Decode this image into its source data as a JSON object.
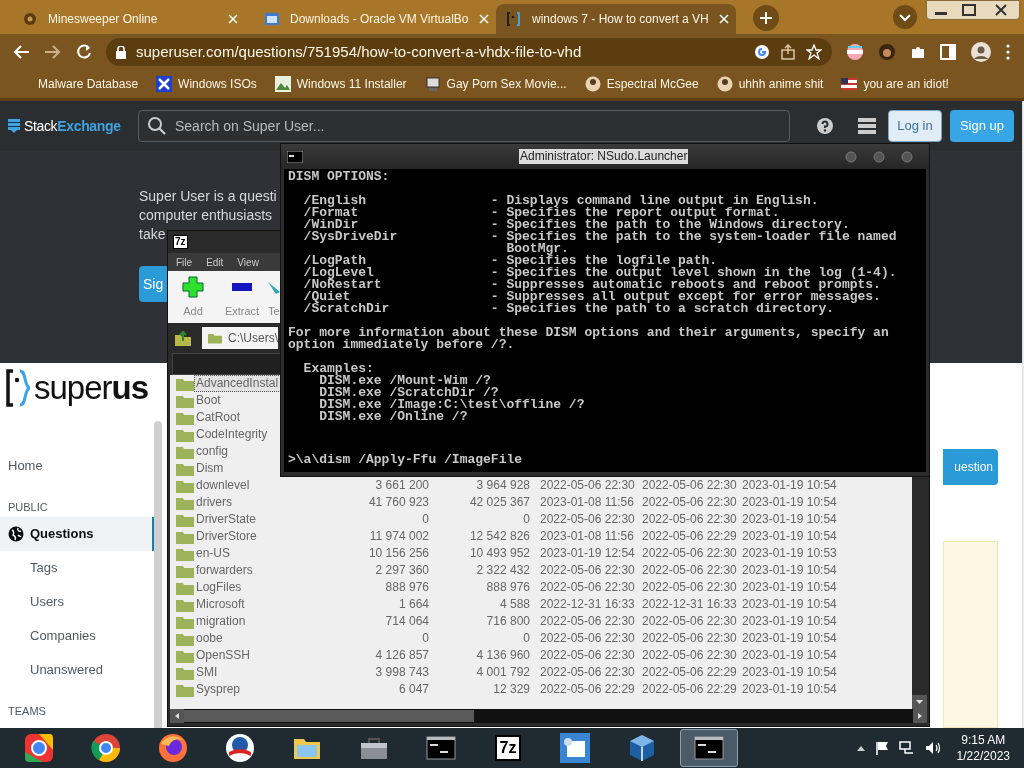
{
  "browser": {
    "tabs": [
      {
        "title": "Minesweeper Online",
        "selected": false,
        "kind": "gear"
      },
      {
        "title": "Downloads - Oracle VM VirtualBo",
        "selected": false,
        "kind": "window"
      },
      {
        "title": "windows 7 - How to convert a VH",
        "selected": true,
        "kind": "bracket"
      }
    ],
    "url": "superuser.com/questions/751954/how-to-convert-a-vhdx-file-to-vhd",
    "bookmarks": [
      {
        "label": "Malware Database",
        "kind": "plain"
      },
      {
        "label": "Windows ISOs",
        "kind": "x"
      },
      {
        "label": "Windows 11 Installer",
        "kind": "image"
      },
      {
        "label": "Gay Porn Sex Movie...",
        "kind": "computer"
      },
      {
        "label": "Espectral McGee",
        "kind": "avatar"
      },
      {
        "label": "uhhh anime shit",
        "kind": "avatar"
      },
      {
        "label": "you are an idiot!",
        "kind": "flag"
      }
    ]
  },
  "site": {
    "logo": "Stack**Exchange**",
    "search_placeholder": "Search on Super User...",
    "login": "Log in",
    "signup": "Sign up",
    "hero_lines": [
      "Super User is a questi",
      "computer enthusiasts",
      "take"
    ],
    "hero_button": "Sig",
    "brand": "super**us**",
    "sidebar": [
      {
        "label": "Home",
        "kind": "link",
        "selected": false
      },
      {
        "label": "PUBLIC",
        "kind": "heading",
        "selected": false
      },
      {
        "label": "Questions",
        "kind": "globelink",
        "selected": true
      },
      {
        "label": "Tags",
        "kind": "sublink",
        "selected": false
      },
      {
        "label": "Users",
        "kind": "sublink",
        "selected": false
      },
      {
        "label": "Companies",
        "kind": "sublink",
        "selected": false
      },
      {
        "label": "Unanswered",
        "kind": "sublink",
        "selected": false
      },
      {
        "label": "TEAMS",
        "kind": "heading",
        "selected": false
      }
    ],
    "ask_button": "uestion"
  },
  "sevenzip": {
    "icon_label": "7z",
    "menu": [
      "File",
      "Edit",
      "View"
    ],
    "toolbar": [
      {
        "label": "Add",
        "kind": "add"
      },
      {
        "label": "Extract",
        "kind": "extract"
      },
      {
        "label": "Te",
        "kind": "test"
      }
    ],
    "path": "C:\\Users\\",
    "rows": [
      {
        "cells": [
          "AdvancedInstal"
        ],
        "selected": true
      },
      {
        "cells": [
          "Boot"
        ],
        "selected": false
      },
      {
        "cells": [
          "CatRoot"
        ],
        "selected": false
      },
      {
        "cells": [
          "CodeIntegrity"
        ],
        "selected": false
      },
      {
        "cells": [
          "config"
        ],
        "selected": false
      },
      {
        "cells": [
          "Dism"
        ],
        "selected": false
      },
      {
        "cells": [
          "downlevel",
          "3 661 200",
          "3 964 928",
          "2022-05-06 22:30",
          "2022-05-06 22:30",
          "2023-01-19 10:54"
        ],
        "selected": false
      },
      {
        "cells": [
          "drivers",
          "41 760 923",
          "42 025 367",
          "2023-01-08 11:56",
          "2022-05-06 22:30",
          "2023-01-19 10:54"
        ],
        "selected": false
      },
      {
        "cells": [
          "DriverState",
          "0",
          "0",
          "2022-05-06 22:30",
          "2022-05-06 22:30",
          "2023-01-19 10:54"
        ],
        "selected": false
      },
      {
        "cells": [
          "DriverStore",
          "11 974 002",
          "12 542 826",
          "2023-01-08 11:56",
          "2022-05-06 22:29",
          "2023-01-19 10:54"
        ],
        "selected": false
      },
      {
        "cells": [
          "en-US",
          "10 156 256",
          "10 493 952",
          "2023-01-19 12:54",
          "2022-05-06 22:30",
          "2023-01-19 10:53"
        ],
        "selected": false
      },
      {
        "cells": [
          "forwarders",
          "2 297 360",
          "2 322 432",
          "2022-05-06 22:30",
          "2022-05-06 22:30",
          "2023-01-19 10:54"
        ],
        "selected": false
      },
      {
        "cells": [
          "LogFiles",
          "888 976",
          "888 976",
          "2022-05-06 22:30",
          "2022-05-06 22:30",
          "2023-01-19 10:54"
        ],
        "selected": false
      },
      {
        "cells": [
          "Microsoft",
          "1 664",
          "4 588",
          "2022-12-31 16:33",
          "2022-12-31 16:33",
          "2023-01-19 10:54"
        ],
        "selected": false
      },
      {
        "cells": [
          "migration",
          "714 064",
          "716 800",
          "2022-05-06 22:30",
          "2022-05-06 22:30",
          "2023-01-19 10:54"
        ],
        "selected": false
      },
      {
        "cells": [
          "oobe",
          "0",
          "0",
          "2022-05-06 22:30",
          "2022-05-06 22:30",
          "2023-01-19 10:54"
        ],
        "selected": false
      },
      {
        "cells": [
          "OpenSSH",
          "4 126 857",
          "4 136 960",
          "2022-05-06 22:30",
          "2022-05-06 22:30",
          "2023-01-19 10:54"
        ],
        "selected": false
      },
      {
        "cells": [
          "SMI",
          "3 998 743",
          "4 001 792",
          "2022-05-06 22:30",
          "2022-05-06 22:29",
          "2023-01-19 10:54"
        ],
        "selected": false
      },
      {
        "cells": [
          "Sysprep",
          "6 047",
          "12 329",
          "2022-05-06 22:29",
          "2022-05-06 22:29",
          "2023-01-19 10:54"
        ],
        "selected": false
      }
    ]
  },
  "console": {
    "title": "Administrator: NSudo.Launcher",
    "heading": "DISM OPTIONS:",
    "options": [
      {
        "flag": "/English",
        "desc": "- Displays command line output in English."
      },
      {
        "flag": "/Format",
        "desc": "- Specifies the report output format."
      },
      {
        "flag": "/WinDir",
        "desc": "- Specifies the path to the Windows directory."
      },
      {
        "flag": "/SysDriveDir",
        "desc": "- Specifies the path to the system-loader file named"
      },
      {
        "cont": "BootMgr."
      },
      {
        "flag": "/LogPath",
        "desc": "- Specifies the logfile path."
      },
      {
        "flag": "/LogLevel",
        "desc": "- Specifies the output level shown in the log (1-4)."
      },
      {
        "flag": "/NoRestart",
        "desc": "- Suppresses automatic reboots and reboot prompts."
      },
      {
        "flag": "/Quiet",
        "desc": "- Suppresses all output except for error messages."
      },
      {
        "flag": "/ScratchDir",
        "desc": "- Specifies the path to a scratch directory."
      }
    ],
    "info": [
      "For more information about these DISM options and their arguments, specify an",
      "option immediately before /?."
    ],
    "examples_label": "Examples:",
    "examples": [
      "DISM.exe /Mount-Wim /?",
      "DISM.exe /ScratchDir /?",
      "DISM.exe /Image:C:\\test\\offline /?",
      "DISM.exe /Online /?"
    ],
    "prompt": ">\\a\\dism /Apply-Ffu /ImageFile"
  },
  "taskbar": {
    "items": [
      {
        "kind": "orb",
        "active": false
      },
      {
        "kind": "chrome",
        "active": false
      },
      {
        "kind": "firefox",
        "active": false
      },
      {
        "kind": "bluecircle",
        "active": false
      },
      {
        "kind": "folder",
        "active": false
      },
      {
        "kind": "toolbox",
        "active": false
      },
      {
        "kind": "console",
        "active": false
      },
      {
        "kind": "sevenzip",
        "label": "7z",
        "active": false
      },
      {
        "kind": "panel",
        "active": false
      },
      {
        "kind": "cube",
        "active": false
      },
      {
        "kind": "console",
        "active": true
      }
    ],
    "time": "9:15 AM",
    "date": "1/22/2023"
  }
}
